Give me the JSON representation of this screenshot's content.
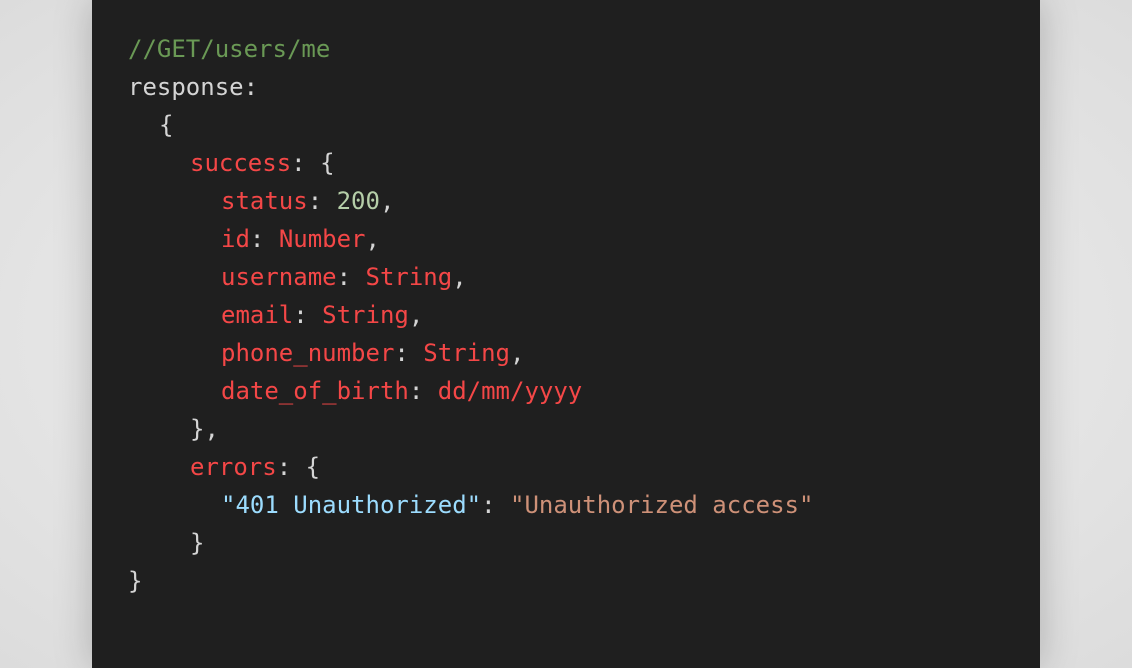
{
  "code": {
    "comment": "//GET/users/me",
    "response_label": "response",
    "colon": ":",
    "open_brace": "{",
    "close_brace": "}",
    "success_key": "success",
    "fields": [
      {
        "key": "status",
        "value": "200"
      },
      {
        "key": "id",
        "value": "Number"
      },
      {
        "key": "username",
        "value": "String"
      },
      {
        "key": "email",
        "value": "String"
      },
      {
        "key": "phone_number",
        "value": "String"
      },
      {
        "key": "date_of_birth",
        "value": "dd/mm/yyyy"
      }
    ],
    "success_close": "},",
    "errors_key": "errors",
    "error_code": "\"401 Unauthorized\"",
    "error_message": "\"Unauthorized access\""
  },
  "colors": {
    "background": "#1f1f1f",
    "comment": "#6a9955",
    "plain": "#d4d4d4",
    "key": "#f44747",
    "number": "#b5cea8",
    "string_key": "#9cdcfe",
    "string": "#ce9178"
  }
}
